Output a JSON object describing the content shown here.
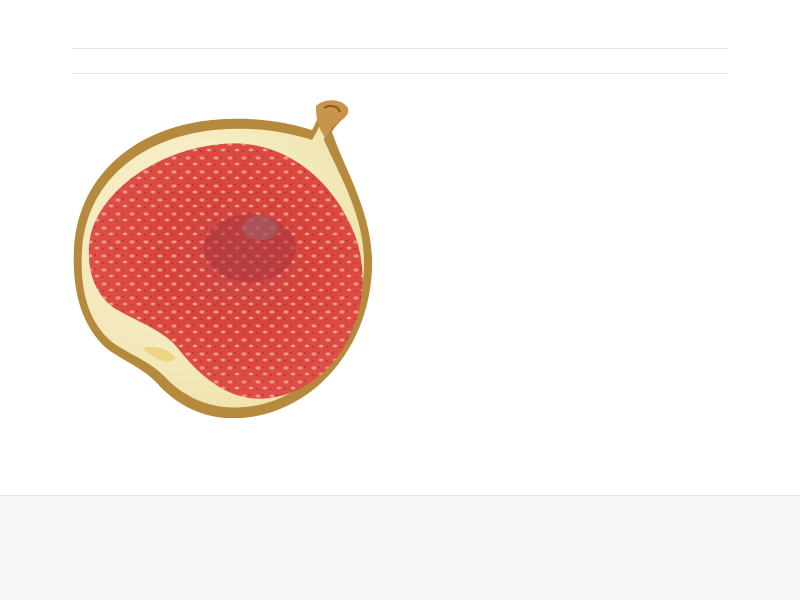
{
  "colors": {
    "page_background": "#ffffff",
    "rule_color": "#e6e6e6",
    "footer_background": "#f8f8f8",
    "fig_flesh": "#d8443a",
    "fig_rind": "#f3e8b8",
    "fig_skin": "#b58a3c"
  },
  "image": {
    "icon": "fig-half-illustration"
  }
}
